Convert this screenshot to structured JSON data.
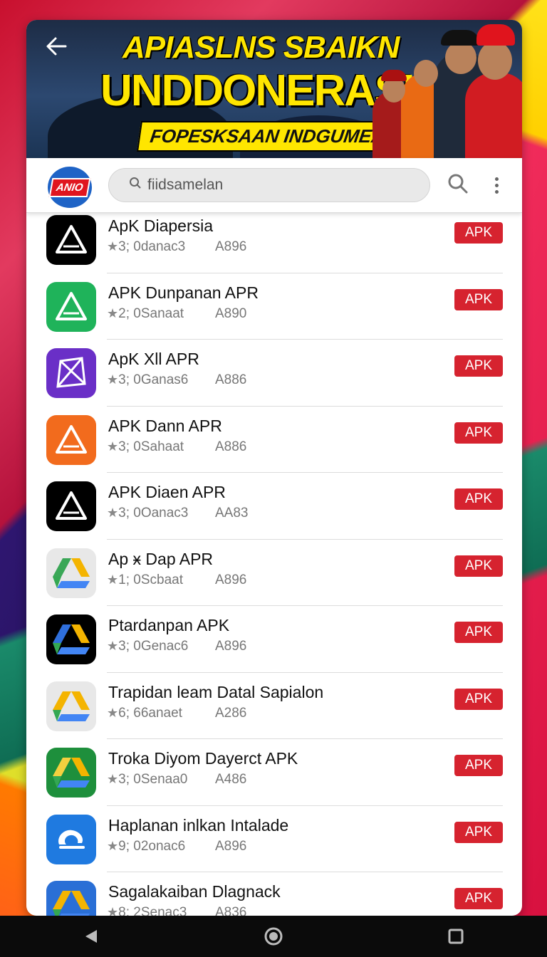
{
  "banner": {
    "line1": "APIASLNS SBAIKN",
    "line2": "UNDDONERASIA",
    "line3": "FOPESKSAAN INDGUMEAN"
  },
  "header": {
    "logo_text": "ANIO",
    "search_placeholder": "fiidsamelan"
  },
  "apps": [
    {
      "name": "ApK Diapersia",
      "rating": "3; 0danac3",
      "size": "A896",
      "badge": "APK",
      "icon": "black-triangle-icon",
      "colors": [
        "#000000",
        "#ffffff"
      ]
    },
    {
      "name": "APK Dunpanan APR",
      "rating": "2; 0Sanaat",
      "size": "A890",
      "badge": "APK",
      "icon": "green-triangle-icon",
      "colors": [
        "#1fb35a",
        "#ffffff"
      ]
    },
    {
      "name": "ApK Xll APR",
      "rating": "3; 0Ganas6",
      "size": "A886",
      "badge": "APK",
      "icon": "purple-prism-icon",
      "colors": [
        "#6a2fc7",
        "#ffffff"
      ]
    },
    {
      "name": "APK Dann APR",
      "rating": "3; 0Sahaat",
      "size": "A886",
      "badge": "APK",
      "icon": "orange-triangle-icon",
      "colors": [
        "#f26b1d",
        "#ffffff"
      ]
    },
    {
      "name": "APK Diaen APR",
      "rating": "3; 0Oanac3",
      "size": "AA83",
      "badge": "APK",
      "icon": "black-triangle-icon",
      "colors": [
        "#000000",
        "#ffffff"
      ]
    },
    {
      "name": "Ap ӿ Dap APR",
      "rating": "1; 0Scbaat",
      "size": "A896",
      "badge": "APK",
      "icon": "drive-triangle-icon",
      "colors": [
        "#e8e8e8",
        "#3aa757"
      ]
    },
    {
      "name": "Ptardanpan APK",
      "rating": "3; 0Genac6",
      "size": "A896",
      "badge": "APK",
      "icon": "drive-triangle-icon",
      "colors": [
        "#000000",
        "#2f6fdc"
      ]
    },
    {
      "name": "Trapidan leam Datal Sapialon",
      "rating": "6; 66anaet",
      "size": "A286",
      "badge": "APK",
      "icon": "drive-triangle-icon",
      "colors": [
        "#e8e8e8",
        "#f4b400"
      ]
    },
    {
      "name": "Troka Diyom Dayerct APK",
      "rating": "3; 0Senaa0",
      "size": "A486",
      "badge": "APK",
      "icon": "green-drive-icon",
      "colors": [
        "#1e8f3c",
        "#f4d03f"
      ]
    },
    {
      "name": "Haplanan inlkan Intalade",
      "rating": "9; 02onac6",
      "size": "A896",
      "badge": "APK",
      "icon": "blue-cloud-icon",
      "colors": [
        "#1f7ae0",
        "#ffffff"
      ]
    },
    {
      "name": "Sagalakaiban Dlagnack",
      "rating": "8; 2Senac3",
      "size": "A836",
      "badge": "APK",
      "icon": "blue-drive-icon",
      "colors": [
        "#2a6fd6",
        "#f4b400"
      ]
    }
  ],
  "accent": "#d6232f"
}
